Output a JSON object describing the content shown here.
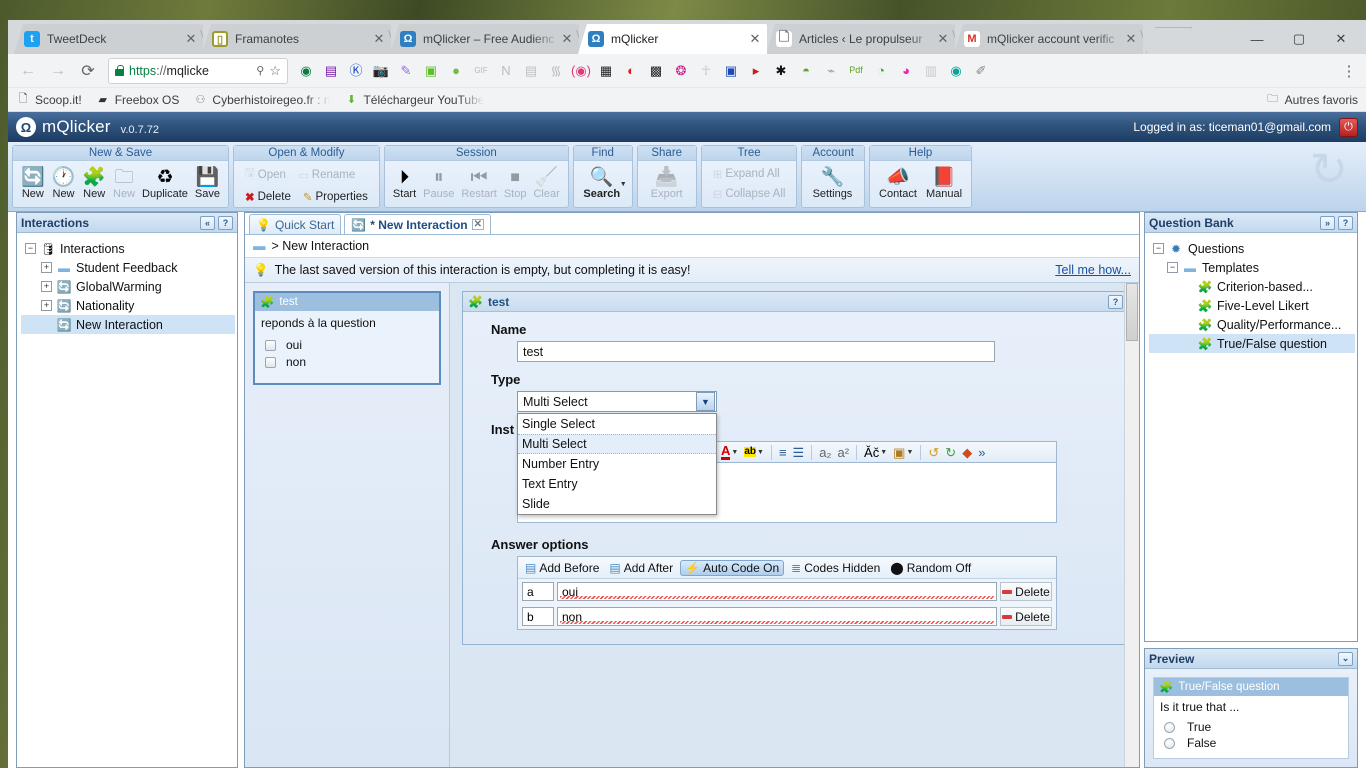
{
  "browser": {
    "tabs": [
      {
        "title": "TweetDeck",
        "favicon": "twitter-icon",
        "active": false
      },
      {
        "title": "Framanotes",
        "favicon": "framanotes-icon",
        "active": false
      },
      {
        "title": "mQlicker – Free Audienc",
        "favicon": "mqlicker-icon",
        "active": false
      },
      {
        "title": "mQlicker",
        "favicon": "mqlicker-icon",
        "active": true
      },
      {
        "title": "Articles ‹ Le propulseur",
        "favicon": "page-icon",
        "active": false
      },
      {
        "title": "mQlicker account verific",
        "favicon": "gmail-icon",
        "active": false
      }
    ],
    "close_label": "✕",
    "window_controls": {
      "minimize": "—",
      "maximize": "▢",
      "close": "✕"
    },
    "nav": {
      "back": "←",
      "forward": "→",
      "reload": "⟳"
    },
    "omnibox": {
      "url_scheme": "https",
      "url_sep": "://",
      "url_host": "mqlicke",
      "pin_icon": "pin-icon",
      "star_icon": "star-icon"
    },
    "menu_dots": "⋮",
    "extensions": [
      "ghostery-icon",
      "onenote-icon",
      "kaspersky-icon",
      "camera-icon",
      "feather-icon",
      "evernote-icon",
      "green-dot-icon",
      "gif-icon",
      "notes-icon",
      "printfriendly-icon",
      "rss-icon",
      "broadcast-icon",
      "qr-icon",
      "opera-icon",
      "qr2-icon",
      "pocket-icon",
      "ankh-icon",
      "readability-icon",
      "video-icon",
      "star-icon",
      "turtle-icon",
      "cast-icon",
      "pdf-icon",
      "frog-icon",
      "pig-icon",
      "grid-icon",
      "search-icon",
      "pen-icon"
    ],
    "bookmarks": [
      {
        "label": "Scoop.it!",
        "icon": "page-icon"
      },
      {
        "label": "Freebox OS",
        "icon": "freebox-icon"
      },
      {
        "label": "Cyberhistoiregeo.fr : n",
        "icon": "owl-icon"
      },
      {
        "label": "Téléchargeur YouTube",
        "icon": "download-icon"
      }
    ],
    "bookmarks_right": {
      "label": "Autres favoris",
      "icon": "folder-icon"
    }
  },
  "app": {
    "brand": "mQlicker",
    "brand_mark": "ℕ",
    "version": "v.0.7.72",
    "logged_in": "Logged in as: ticeman01@gmail.com",
    "power_icon": "power-icon"
  },
  "ribbon": {
    "groups": [
      {
        "title": "New & Save",
        "buttons": [
          {
            "label": "New",
            "icon": "new-interaction-icon",
            "disabled": false,
            "glyph": "🔄"
          },
          {
            "label": "New",
            "icon": "new-session-icon",
            "disabled": false,
            "glyph": "🕐"
          },
          {
            "label": "New",
            "icon": "new-question-icon",
            "disabled": false,
            "glyph": "🧩"
          },
          {
            "label": "New",
            "icon": "new-folder-icon",
            "disabled": true,
            "glyph": "📁"
          },
          {
            "label": "Duplicate",
            "icon": "duplicate-icon",
            "disabled": false,
            "glyph": "📄"
          },
          {
            "label": "Save",
            "icon": "save-icon",
            "disabled": false,
            "glyph": "💾"
          }
        ]
      },
      {
        "title": "Open & Modify",
        "rows": [
          [
            {
              "label": "Open",
              "icon": "open-icon",
              "disabled": true,
              "glyph": "🖨"
            },
            {
              "label": "Rename",
              "icon": "rename-icon",
              "disabled": true,
              "glyph": "⌨"
            }
          ],
          [
            {
              "label": "Delete",
              "icon": "delete-icon",
              "disabled": false,
              "glyph": "✖"
            },
            {
              "label": "Properties",
              "icon": "properties-icon",
              "disabled": false,
              "glyph": "📝"
            }
          ]
        ]
      },
      {
        "title": "Session",
        "buttons": [
          {
            "label": "Start",
            "icon": "play-icon",
            "disabled": false,
            "glyph": "▶"
          },
          {
            "label": "Pause",
            "icon": "pause-icon",
            "disabled": true,
            "glyph": "⏸"
          },
          {
            "label": "Restart",
            "icon": "restart-icon",
            "disabled": true,
            "glyph": "⏮"
          },
          {
            "label": "Stop",
            "icon": "stop-icon",
            "disabled": true,
            "glyph": "⏹"
          },
          {
            "label": "Clear",
            "icon": "clear-icon",
            "disabled": true,
            "glyph": "🧹"
          }
        ]
      },
      {
        "title": "Find",
        "buttons": [
          {
            "label": "Search",
            "icon": "search-icon",
            "disabled": false,
            "glyph": "🔍"
          }
        ]
      },
      {
        "title": "Share",
        "buttons": [
          {
            "label": "Export",
            "icon": "export-icon",
            "disabled": true,
            "glyph": "📥"
          }
        ]
      },
      {
        "title": "Tree",
        "rows": [
          [
            {
              "label": "Expand All",
              "icon": "expand-all-icon",
              "disabled": true,
              "glyph": "⊞"
            }
          ],
          [
            {
              "label": "Collapse All",
              "icon": "collapse-all-icon",
              "disabled": true,
              "glyph": "⊟"
            }
          ]
        ]
      },
      {
        "title": "Account",
        "buttons": [
          {
            "label": "Settings",
            "icon": "settings-icon",
            "disabled": false,
            "glyph": "🔧"
          }
        ]
      },
      {
        "title": "Help",
        "buttons": [
          {
            "label": "Contact",
            "icon": "contact-icon",
            "disabled": false,
            "glyph": "📣"
          },
          {
            "label": "Manual",
            "icon": "manual-icon",
            "disabled": false,
            "glyph": "📕"
          }
        ]
      }
    ]
  },
  "left_panel": {
    "title": "Interactions",
    "collapse_label": "«",
    "help_label": "?",
    "tree": [
      {
        "label": "Interactions",
        "icon": "database-icon",
        "level": 0,
        "expander": "−",
        "selected": false
      },
      {
        "label": "Student Feedback",
        "icon": "folder-icon",
        "level": 1,
        "expander": "+",
        "selected": false
      },
      {
        "label": "GlobalWarming",
        "icon": "interaction-icon",
        "level": 1,
        "expander": "+",
        "selected": false
      },
      {
        "label": "Nationality",
        "icon": "interaction-icon",
        "level": 1,
        "expander": "+",
        "selected": false
      },
      {
        "label": "New Interaction",
        "icon": "interaction-icon",
        "level": 1,
        "expander": "",
        "selected": true
      }
    ]
  },
  "center": {
    "tabs": [
      {
        "label": "Quick Start",
        "icon": "lightbulb-icon",
        "active": false,
        "closable": false
      },
      {
        "label": "* New Interaction",
        "icon": "interaction-icon",
        "active": true,
        "closable": true,
        "close": "✕"
      }
    ],
    "breadcrumb": {
      "icon": "folder-icon",
      "text": "> New Interaction"
    },
    "notice": {
      "icon": "lightbulb-icon",
      "text": "The last saved version of this interaction is empty, but completing it is easy!",
      "link": "Tell me how..."
    },
    "slide_card": {
      "title": "test",
      "icon": "puzzle-icon",
      "question": "reponds à la question",
      "options": [
        "oui",
        "non"
      ]
    },
    "question_panel": {
      "title": "test",
      "icon": "puzzle-icon",
      "help": "?",
      "name_label": "Name",
      "name_value": "test",
      "type_label": "Type",
      "type_value": "Multi Select",
      "type_options": [
        "Single Select",
        "Multi Select",
        "Number Entry",
        "Text Entry",
        "Slide"
      ],
      "type_selected": "Multi Select",
      "instructions_label": "Inst",
      "rte_buttons": [
        "font-color-icon",
        "highlight-icon",
        "numbered-list-icon",
        "bullet-list-icon",
        "subscript-icon",
        "superscript-icon",
        "special-char-icon",
        "image-icon",
        "undo-icon",
        "redo-icon",
        "eraser-icon",
        "more-icon"
      ],
      "answer_options_label": "Answer options",
      "answer_toolbar": [
        {
          "label": "Add Before",
          "icon": "add-before-icon",
          "active": false
        },
        {
          "label": "Add After",
          "icon": "add-after-icon",
          "active": false
        },
        {
          "label": "Auto Code On",
          "icon": "lightning-icon",
          "active": true
        },
        {
          "label": "Codes Hidden",
          "icon": "codes-icon",
          "active": false
        },
        {
          "label": "Random Off",
          "icon": "dice-icon",
          "active": false
        }
      ],
      "answers": [
        {
          "code": "a",
          "text": "oui",
          "delete": "Delete"
        },
        {
          "code": "b",
          "text": "non",
          "delete": "Delete"
        }
      ]
    }
  },
  "right_panel": {
    "question_bank": {
      "title": "Question Bank",
      "expand_label": "»",
      "help_label": "?",
      "tree": [
        {
          "label": "Questions",
          "icon": "questions-icon",
          "level": 0,
          "expander": "−",
          "selected": false
        },
        {
          "label": "Templates",
          "icon": "folder-icon",
          "level": 1,
          "expander": "−",
          "selected": false
        },
        {
          "label": "Criterion-based...",
          "icon": "puzzle-icon",
          "level": 2,
          "expander": "",
          "selected": false
        },
        {
          "label": "Five-Level Likert",
          "icon": "puzzle-icon",
          "level": 2,
          "expander": "",
          "selected": false
        },
        {
          "label": "Quality/Performance...",
          "icon": "puzzle-icon",
          "level": 2,
          "expander": "",
          "selected": false
        },
        {
          "label": "True/False question",
          "icon": "puzzle-icon",
          "level": 2,
          "expander": "",
          "selected": true
        }
      ]
    },
    "preview": {
      "title": "Preview",
      "collapse_label": "⌄",
      "card_title": "True/False question",
      "card_icon": "puzzle-icon",
      "question": "Is it true that ...",
      "options": [
        "True",
        "False"
      ]
    }
  }
}
